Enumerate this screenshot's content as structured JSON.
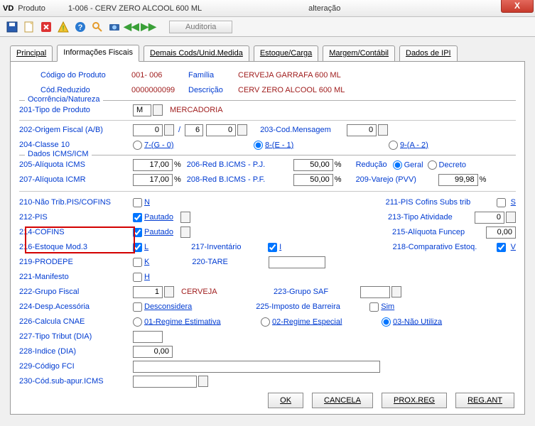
{
  "title": {
    "vd": "VD",
    "part1": "Produto",
    "part2": "1-006 - CERV ZERO ALCOOL 600 ML",
    "part3": "alteração"
  },
  "auditoria": "Auditoria",
  "close_x": "X",
  "tabs": {
    "principal": "Principal",
    "fiscais": "Informações Fiscais",
    "demais": "Demais Cods/Unid.Medida",
    "estoque": "Estoque/Carga",
    "margem": "Margem/Contábil",
    "ipi": "Dados de IPI"
  },
  "hdr": {
    "cod_prod_lbl": "Código do Produto",
    "cod_prod_val": "001- 006",
    "familia_lbl": "Família",
    "familia_val": "CERVEJA GARRAFA  600 ML",
    "cod_red_lbl": "Cód.Reduzido",
    "cod_red_val": "0000000099",
    "desc_lbl": "Descrição",
    "desc_val": "CERV ZERO ALCOOL 600 ML"
  },
  "groups": {
    "ocorrencia": "Ocorrência/Natureza",
    "dados_icms": "Dados ICMS/ICM"
  },
  "f201": {
    "lbl": "201-Tipo de Produto",
    "val": "M",
    "desc": "MERCADORIA"
  },
  "f202": {
    "lbl": "202-Origem Fiscal (A/B)",
    "a": "0",
    "b1": "6",
    "b2": "0"
  },
  "f203": {
    "lbl": "203-Cod.Mensagem",
    "val": "0"
  },
  "f204": {
    "lbl": "204-Classe 10",
    "opt7": "7-(G - 0)",
    "opt8": "8-(E - 1)",
    "opt9": "9-(A - 2)"
  },
  "f205": {
    "lbl": "205-Alíquota ICMS",
    "val": "17,00"
  },
  "f206": {
    "lbl": "206-Red B.ICMS - P.J.",
    "val": "50,00"
  },
  "reducao": {
    "lbl": "Redução",
    "geral": "Geral",
    "decreto": "Decreto"
  },
  "f207": {
    "lbl": "207-Alíquota ICMR",
    "val": "17,00"
  },
  "f208": {
    "lbl": "208-Red B.ICMS - P.F.",
    "val": "50,00"
  },
  "f209": {
    "lbl": "209-Varejo (PVV)",
    "val": "99,98"
  },
  "f210": {
    "lbl": "210-Não Trib.PIS/COFINS",
    "chk": "N"
  },
  "f211": {
    "lbl": "211-PIS Cofins Subs trib",
    "chk": "S"
  },
  "f212": {
    "lbl": "212-PIS",
    "chk": "Pautado"
  },
  "f213": {
    "lbl": "213-Tipo Atividade",
    "val": "0"
  },
  "f214": {
    "lbl": "214-COFINS",
    "chk": "Pautado"
  },
  "f215": {
    "lbl": "215-Alíquota Funcep",
    "val": "0,00"
  },
  "f216": {
    "lbl": "216-Estoque Mod.3",
    "chk": "L"
  },
  "f217": {
    "lbl": "217-Inventário",
    "chk": "I"
  },
  "f218": {
    "lbl": "218-Comparativo Estoq.",
    "chk": "V"
  },
  "f219": {
    "lbl": "219-PRODEPE",
    "chk": "K"
  },
  "f220": {
    "lbl": "220-TARE",
    "val": ""
  },
  "f221": {
    "lbl": "221-Manifesto",
    "chk": "H"
  },
  "f222": {
    "lbl": "222-Grupo Fiscal",
    "val": "1",
    "desc": "CERVEJA"
  },
  "f223": {
    "lbl": "223-Grupo SAF",
    "val": ""
  },
  "f224": {
    "lbl": "224-Desp.Acessória",
    "chk": "Desconsidera"
  },
  "f225": {
    "lbl": "225-Imposto de Barreira",
    "chk": "Sim"
  },
  "f226": {
    "lbl": "226-Calcula CNAE",
    "opt1": "01-Regime Estimativa",
    "opt2": "02-Regime Especial",
    "opt3": "03-Não Utiliza"
  },
  "f227": {
    "lbl": "227-Tipo Tribut (DIA)",
    "val": ""
  },
  "f228": {
    "lbl": "228-Indice (DIA)",
    "val": "0,00"
  },
  "f229": {
    "lbl": "229-Código FCI",
    "val": ""
  },
  "f230": {
    "lbl": "230-Cód.sub-apur.ICMS",
    "val": ""
  },
  "btns": {
    "ok": "OK",
    "cancela": "CANCELA",
    "prox": "PROX.REG",
    "regant": "REG.ANT"
  },
  "pct": "%",
  "slash": "/"
}
